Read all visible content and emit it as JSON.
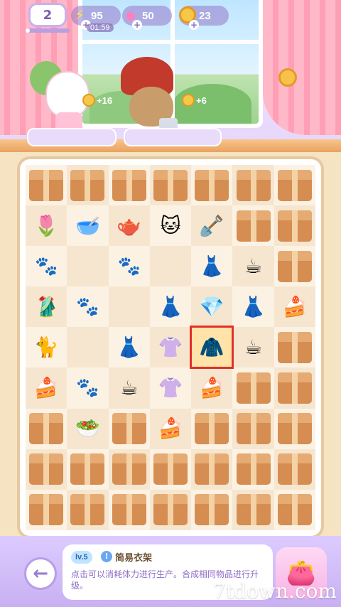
{
  "hud": {
    "level": "2",
    "xp_fraction": 0.1,
    "energy": {
      "value": "95",
      "timer": "01:59",
      "icon": "lightning-icon"
    },
    "gems": {
      "value": "50",
      "icon": "gem-icon"
    },
    "coins": {
      "value": "23",
      "icon": "coin-icon"
    }
  },
  "customers": [
    {
      "name": "white-cat-customer",
      "reward": "+16"
    },
    {
      "name": "witch-cat-customer",
      "reward": "+6"
    }
  ],
  "board": {
    "rows": [
      [
        "box",
        "box",
        "box",
        "box",
        "box",
        "box",
        "box"
      ],
      [
        "tulip",
        "bowl",
        "teapot",
        "cat",
        "shovel",
        "box",
        "box"
      ],
      [
        "paw",
        "empty",
        "paw",
        "empty",
        "dress",
        "spilled-cup",
        "box"
      ],
      [
        "robe",
        "paw",
        "empty",
        "dress",
        "gem-cloth",
        "dress",
        "cake"
      ],
      [
        "cat-box",
        "empty",
        "dress",
        "blouse",
        "rack",
        "cup",
        "box"
      ],
      [
        "cake",
        "paw",
        "cup",
        "blouse",
        "cake",
        "box",
        "box"
      ],
      [
        "box",
        "salad",
        "box",
        "cake",
        "box",
        "box",
        "box"
      ],
      [
        "box",
        "box",
        "box",
        "box",
        "box",
        "box",
        "box"
      ],
      [
        "box",
        "box",
        "box",
        "box",
        "box",
        "box",
        "box"
      ]
    ],
    "selected": {
      "row": 4,
      "col": 4
    }
  },
  "info_panel": {
    "level": "lv.5",
    "name": "简易衣架",
    "description": "点击可以消耗体力进行生产。合成相同物品进行升级。"
  },
  "watermark": "7tdown.com",
  "colors": {
    "accent": "#b89de8",
    "box": "#d58d52",
    "selection": "#e1302a"
  }
}
